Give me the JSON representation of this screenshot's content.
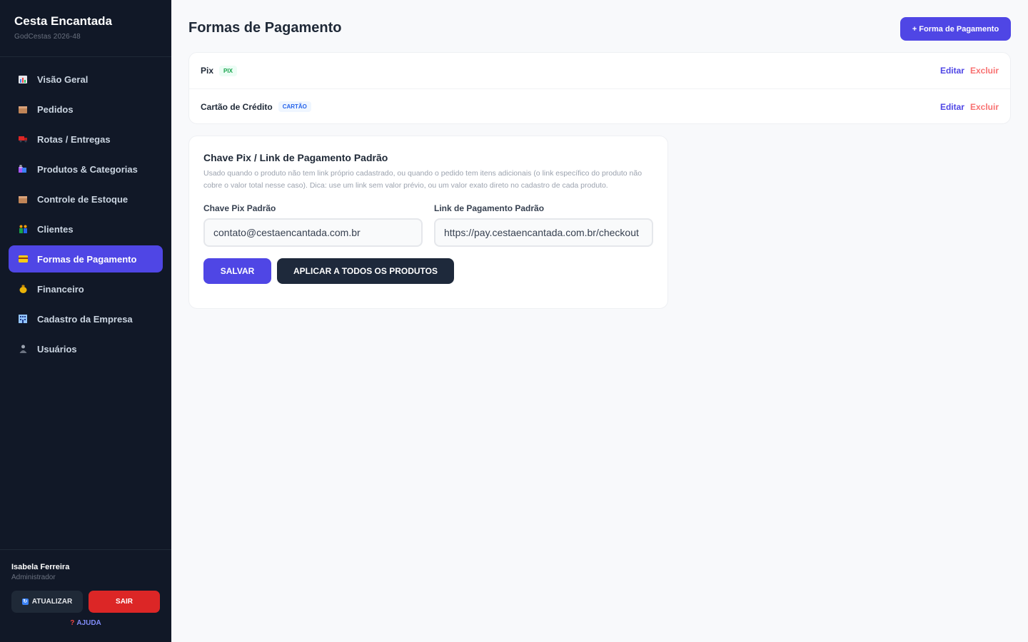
{
  "sidebar": {
    "brand_title": "Cesta Encantada",
    "brand_subtitle": "GodCestas 2026-48",
    "items": [
      {
        "label": "Visão Geral",
        "icon": "chart-icon",
        "active": false
      },
      {
        "label": "Pedidos",
        "icon": "package-icon",
        "active": false
      },
      {
        "label": "Rotas / Entregas",
        "icon": "truck-icon",
        "active": false
      },
      {
        "label": "Produtos & Categorias",
        "icon": "shopping-bags-icon",
        "active": false
      },
      {
        "label": "Controle de Estoque",
        "icon": "box-icon",
        "active": false
      },
      {
        "label": "Clientes",
        "icon": "people-icon",
        "active": false
      },
      {
        "label": "Formas de Pagamento",
        "icon": "credit-card-icon",
        "active": true
      },
      {
        "label": "Financeiro",
        "icon": "money-bag-icon",
        "active": false
      },
      {
        "label": "Cadastro da Empresa",
        "icon": "building-icon",
        "active": false
      },
      {
        "label": "Usuários",
        "icon": "user-icon",
        "active": false
      }
    ],
    "user": {
      "name": "Isabela Ferreira",
      "role": "Administrador"
    },
    "update_label": "ATUALIZAR",
    "logout_label": "SAIR",
    "help_label": "AJUDA"
  },
  "header": {
    "title": "Formas de Pagamento",
    "add_label": "+ Forma de Pagamento"
  },
  "methods": [
    {
      "name": "Pix",
      "tag": "PIX",
      "edit": "Editar",
      "delete": "Excluir"
    },
    {
      "name": "Cartão de Crédito",
      "tag": "CARTÃO",
      "edit": "Editar",
      "delete": "Excluir"
    }
  ],
  "pix_section": {
    "title": "Chave Pix / Link de Pagamento Padrão",
    "description": "Usado quando o produto não tem link próprio cadastrado, ou quando o pedido tem itens adicionais (o link específico do produto não cobre o valor total nesse caso). Dica: use um link sem valor prévio, ou um valor exato direto no cadastro de cada produto.",
    "pix_label": "Chave Pix Padrão",
    "pix_value": "contato@cestaencantada.com.br",
    "link_label": "Link de Pagamento Padrão",
    "link_value": "https://pay.cestaencantada.com.br/checkout",
    "save_label": "SALVAR",
    "apply_label": "APLICAR A TODOS OS PRODUTOS"
  },
  "colors": {
    "sidebar_bg": "#111827",
    "accent": "#4f46e5",
    "danger": "#dc2626",
    "dark_button": "#1e293b",
    "page_bg": "#f8f9fb"
  }
}
